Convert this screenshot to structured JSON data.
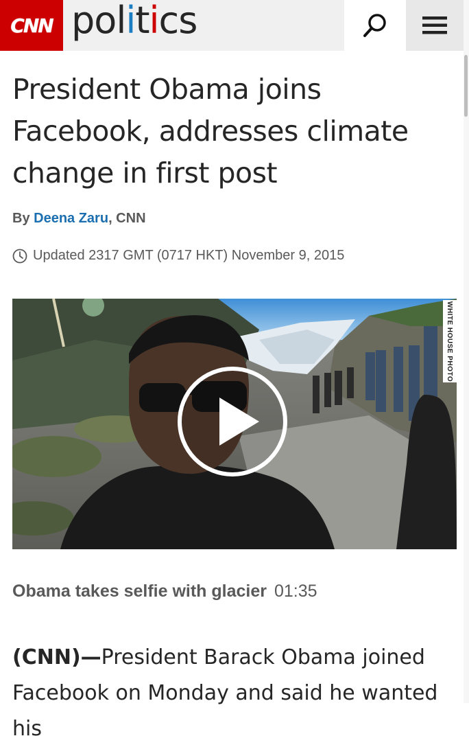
{
  "header": {
    "logo": "CNN",
    "section_parts": [
      "pol",
      "i",
      "t",
      "i",
      "cs"
    ],
    "section_full": "politics",
    "colors": {
      "brand_red": "#cc0000",
      "accent_blue": "#1b7ec2"
    },
    "search_icon": "search-icon",
    "menu_icon": "hamburger-menu-icon"
  },
  "article": {
    "headline": "President Obama joins Facebook, addresses climate change in first post",
    "byline_prefix": "By ",
    "author": "Deena Zaru",
    "byline_suffix": ", CNN",
    "updated": "Updated 2317 GMT (0717 HKT) November 9, 2015",
    "video": {
      "credit": "WHITE HOUSE PHOTO",
      "caption_title": "Obama takes selfie with glacier",
      "duration": "01:35"
    },
    "lead_label": "(CNN)",
    "lead_dash": "—",
    "body_text": "President Barack Obama joined Facebook on Monday and said he wanted his"
  }
}
